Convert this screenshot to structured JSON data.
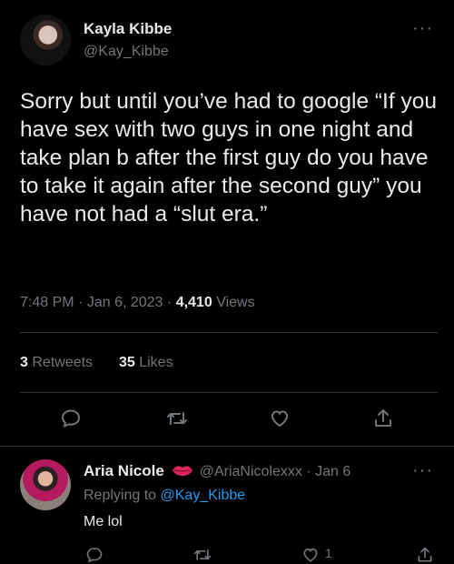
{
  "tweet": {
    "author_name": "Kayla Kibbe",
    "author_handle": "@Kay_Kibbe",
    "more_label": "···",
    "text": "Sorry but until you’ve had to google “If you have sex with two guys in one night and take plan b after the first guy do you have to take it again after the second guy” you have not had a “slut era.”",
    "time": "7:48 PM",
    "sep1": "·",
    "date": "Jan 6, 2023",
    "sep2": "·",
    "views_count": "4,410",
    "views_label": "Views",
    "retweets_count": "3",
    "retweets_label": "Retweets",
    "likes_count": "35",
    "likes_label": "Likes"
  },
  "reply": {
    "author_name": "Aria Nicole",
    "author_handle": "@AriaNicolexxx",
    "sep": "·",
    "date": "Jan 6",
    "more_label": "···",
    "replying_label": "Replying to",
    "replying_handle": "@Kay_Kibbe",
    "text": "Me lol",
    "like_count": "1"
  },
  "colors": {
    "background": "#000000",
    "text": "#e7e9ea",
    "muted": "#71767b",
    "link": "#1d9bf0",
    "divider": "#2f3336",
    "lips": "#e0245e"
  },
  "icons": {
    "reply": "reply-icon",
    "retweet": "retweet-icon",
    "like": "heart-icon",
    "share": "share-icon",
    "lips": "lips-emoji-icon"
  }
}
